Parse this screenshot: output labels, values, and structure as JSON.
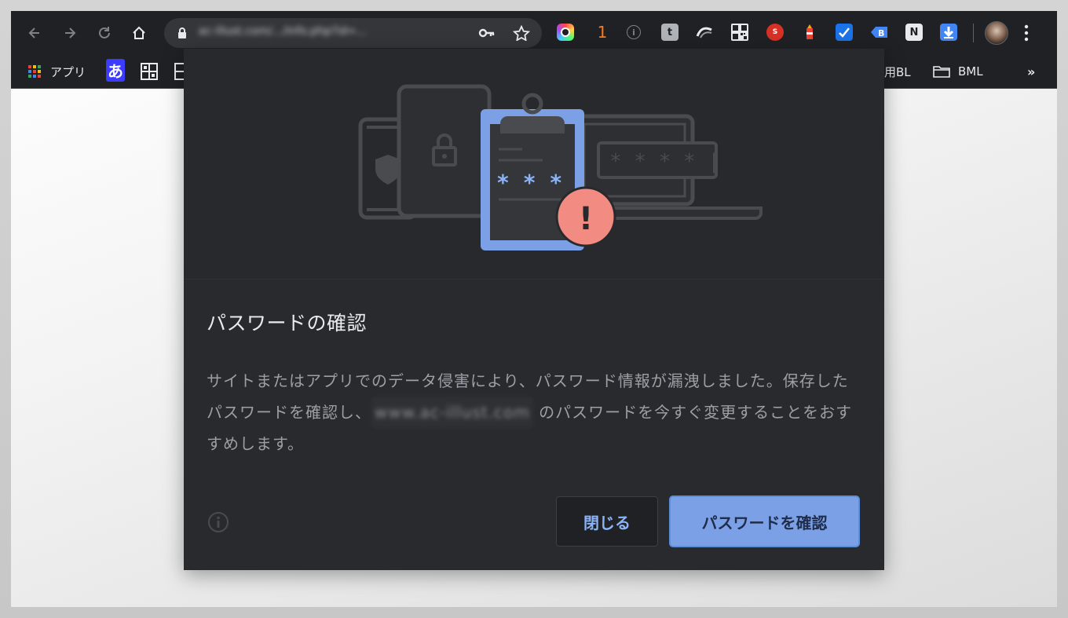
{
  "browser": {
    "url": "ac-illust.com/.../info.php?id=...",
    "extension_badge_count": "1"
  },
  "bookmarks": {
    "apps_label": "アプリ",
    "hiragana_label": "あ",
    "right_item_1": "用BL",
    "right_item_2": "BML",
    "overflow": "»"
  },
  "dialog": {
    "illustration_password_field": "* * * * |",
    "illustration_clipboard_stars": "* * *",
    "illustration_alert": "!",
    "title": "パスワードの確認",
    "body_part1": "サイトまたはアプリでのデータ侵害により、パスワード情報が漏洩しました。保存したパスワードを確認し、",
    "body_site": "www.ac-illust.com",
    "body_part2": " のパスワードを今すぐ変更することをおすすめします。",
    "close_label": "閉じる",
    "check_label": "パスワードを確認"
  },
  "colors": {
    "toolbar_bg": "#202124",
    "dialog_bg": "#292a2d",
    "accent_blue": "#8ab4f8",
    "primary_button": "#7ba0e6",
    "alert_red": "#f28b82"
  }
}
